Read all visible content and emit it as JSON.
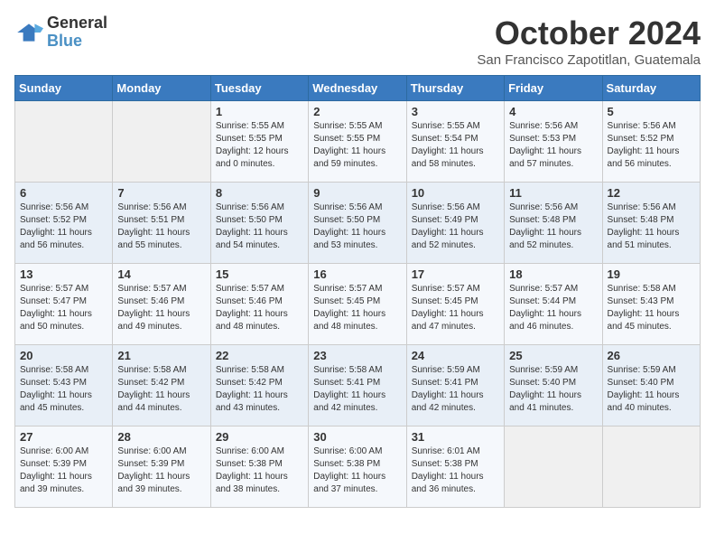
{
  "logo": {
    "text_general": "General",
    "text_blue": "Blue"
  },
  "title": "October 2024",
  "subtitle": "San Francisco Zapotitlan, Guatemala",
  "days_of_week": [
    "Sunday",
    "Monday",
    "Tuesday",
    "Wednesday",
    "Thursday",
    "Friday",
    "Saturday"
  ],
  "weeks": [
    [
      {
        "day": "",
        "info": ""
      },
      {
        "day": "",
        "info": ""
      },
      {
        "day": "1",
        "info": "Sunrise: 5:55 AM\nSunset: 5:55 PM\nDaylight: 12 hours and 0 minutes."
      },
      {
        "day": "2",
        "info": "Sunrise: 5:55 AM\nSunset: 5:55 PM\nDaylight: 11 hours and 59 minutes."
      },
      {
        "day": "3",
        "info": "Sunrise: 5:55 AM\nSunset: 5:54 PM\nDaylight: 11 hours and 58 minutes."
      },
      {
        "day": "4",
        "info": "Sunrise: 5:56 AM\nSunset: 5:53 PM\nDaylight: 11 hours and 57 minutes."
      },
      {
        "day": "5",
        "info": "Sunrise: 5:56 AM\nSunset: 5:52 PM\nDaylight: 11 hours and 56 minutes."
      }
    ],
    [
      {
        "day": "6",
        "info": "Sunrise: 5:56 AM\nSunset: 5:52 PM\nDaylight: 11 hours and 56 minutes."
      },
      {
        "day": "7",
        "info": "Sunrise: 5:56 AM\nSunset: 5:51 PM\nDaylight: 11 hours and 55 minutes."
      },
      {
        "day": "8",
        "info": "Sunrise: 5:56 AM\nSunset: 5:50 PM\nDaylight: 11 hours and 54 minutes."
      },
      {
        "day": "9",
        "info": "Sunrise: 5:56 AM\nSunset: 5:50 PM\nDaylight: 11 hours and 53 minutes."
      },
      {
        "day": "10",
        "info": "Sunrise: 5:56 AM\nSunset: 5:49 PM\nDaylight: 11 hours and 52 minutes."
      },
      {
        "day": "11",
        "info": "Sunrise: 5:56 AM\nSunset: 5:48 PM\nDaylight: 11 hours and 52 minutes."
      },
      {
        "day": "12",
        "info": "Sunrise: 5:56 AM\nSunset: 5:48 PM\nDaylight: 11 hours and 51 minutes."
      }
    ],
    [
      {
        "day": "13",
        "info": "Sunrise: 5:57 AM\nSunset: 5:47 PM\nDaylight: 11 hours and 50 minutes."
      },
      {
        "day": "14",
        "info": "Sunrise: 5:57 AM\nSunset: 5:46 PM\nDaylight: 11 hours and 49 minutes."
      },
      {
        "day": "15",
        "info": "Sunrise: 5:57 AM\nSunset: 5:46 PM\nDaylight: 11 hours and 48 minutes."
      },
      {
        "day": "16",
        "info": "Sunrise: 5:57 AM\nSunset: 5:45 PM\nDaylight: 11 hours and 48 minutes."
      },
      {
        "day": "17",
        "info": "Sunrise: 5:57 AM\nSunset: 5:45 PM\nDaylight: 11 hours and 47 minutes."
      },
      {
        "day": "18",
        "info": "Sunrise: 5:57 AM\nSunset: 5:44 PM\nDaylight: 11 hours and 46 minutes."
      },
      {
        "day": "19",
        "info": "Sunrise: 5:58 AM\nSunset: 5:43 PM\nDaylight: 11 hours and 45 minutes."
      }
    ],
    [
      {
        "day": "20",
        "info": "Sunrise: 5:58 AM\nSunset: 5:43 PM\nDaylight: 11 hours and 45 minutes."
      },
      {
        "day": "21",
        "info": "Sunrise: 5:58 AM\nSunset: 5:42 PM\nDaylight: 11 hours and 44 minutes."
      },
      {
        "day": "22",
        "info": "Sunrise: 5:58 AM\nSunset: 5:42 PM\nDaylight: 11 hours and 43 minutes."
      },
      {
        "day": "23",
        "info": "Sunrise: 5:58 AM\nSunset: 5:41 PM\nDaylight: 11 hours and 42 minutes."
      },
      {
        "day": "24",
        "info": "Sunrise: 5:59 AM\nSunset: 5:41 PM\nDaylight: 11 hours and 42 minutes."
      },
      {
        "day": "25",
        "info": "Sunrise: 5:59 AM\nSunset: 5:40 PM\nDaylight: 11 hours and 41 minutes."
      },
      {
        "day": "26",
        "info": "Sunrise: 5:59 AM\nSunset: 5:40 PM\nDaylight: 11 hours and 40 minutes."
      }
    ],
    [
      {
        "day": "27",
        "info": "Sunrise: 6:00 AM\nSunset: 5:39 PM\nDaylight: 11 hours and 39 minutes."
      },
      {
        "day": "28",
        "info": "Sunrise: 6:00 AM\nSunset: 5:39 PM\nDaylight: 11 hours and 39 minutes."
      },
      {
        "day": "29",
        "info": "Sunrise: 6:00 AM\nSunset: 5:38 PM\nDaylight: 11 hours and 38 minutes."
      },
      {
        "day": "30",
        "info": "Sunrise: 6:00 AM\nSunset: 5:38 PM\nDaylight: 11 hours and 37 minutes."
      },
      {
        "day": "31",
        "info": "Sunrise: 6:01 AM\nSunset: 5:38 PM\nDaylight: 11 hours and 36 minutes."
      },
      {
        "day": "",
        "info": ""
      },
      {
        "day": "",
        "info": ""
      }
    ]
  ]
}
